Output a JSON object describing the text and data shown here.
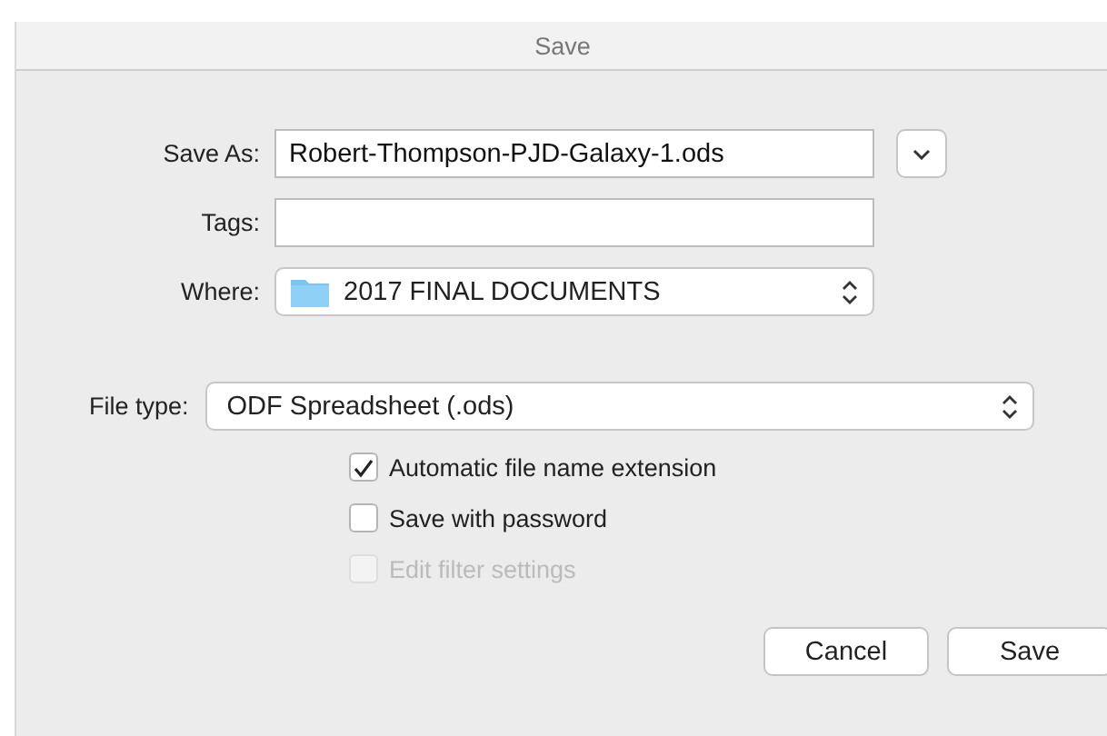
{
  "window": {
    "title": "Save"
  },
  "save_as": {
    "label": "Save As:",
    "value": "Robert-Thompson-PJD-Galaxy-1.ods",
    "expanded": false
  },
  "tags": {
    "label": "Tags:"
  },
  "where": {
    "label": "Where:",
    "value": "2017 FINAL DOCUMENTS"
  },
  "file_type": {
    "label": "File type:",
    "value": "ODF Spreadsheet (.ods)"
  },
  "options": [
    {
      "label": "Automatic file name extension",
      "checked": true,
      "disabled": false
    },
    {
      "label": "Save with password",
      "checked": false,
      "disabled": false
    },
    {
      "label": "Edit filter settings",
      "checked": false,
      "disabled": true
    }
  ],
  "buttons": [
    {
      "label": "Cancel"
    },
    {
      "label": "Save"
    }
  ]
}
